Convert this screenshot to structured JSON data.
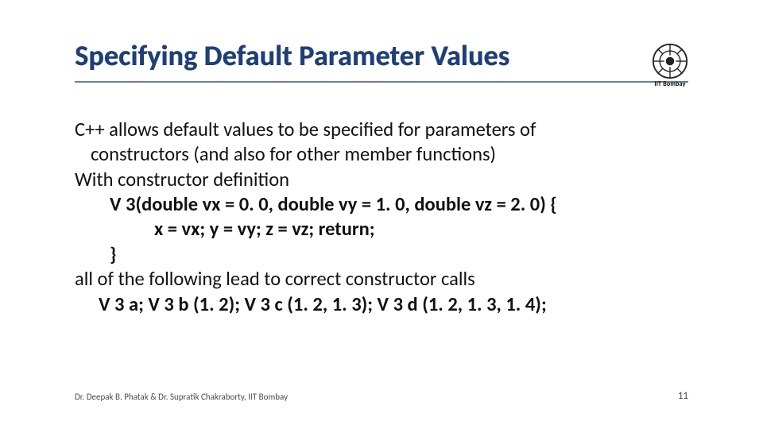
{
  "header": {
    "title": "Specifying Default Parameter Values",
    "logo_caption": "IIT Bombay"
  },
  "body": {
    "line1": "C++ allows default values to be specified for parameters of",
    "line2": "constructors (and also for other member functions)",
    "line3": "With constructor definition",
    "code_line1": "V 3(double vx = 0. 0, double vy = 1. 0,  double vz = 2. 0) {",
    "code_line2": "x = vx; y = vy; z = vz; return;",
    "code_line3": "}",
    "line4": "all of the following lead to correct constructor calls",
    "examples": "V 3 a;  V 3 b (1. 2);  V 3 c (1. 2, 1. 3);  V 3 d (1. 2, 1. 3, 1. 4);"
  },
  "footer": {
    "left": "Dr. Deepak B. Phatak & Dr. Supratik Chakraborty, IIT Bombay",
    "page": "11"
  }
}
